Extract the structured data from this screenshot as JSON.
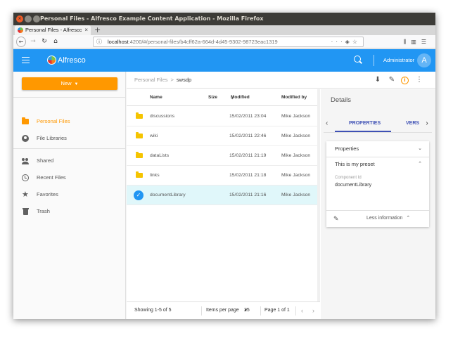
{
  "window": {
    "title": "Personal Files - Alfresco Example Content Application - Mozilla Firefox",
    "tab_title": "Personal Files - Alfresco",
    "new_tab": "+",
    "url_host": "localhost",
    "url_rest": ":4200/#/personal-files/b4cff62a-664d-4d45-9302-98723eac1319"
  },
  "app": {
    "logo_text": "Alfresco",
    "username": "Administrator",
    "avatar_letter": "A"
  },
  "sidebar": {
    "new_button": "New",
    "items": [
      {
        "label": "Personal Files",
        "icon": "folder-icon"
      },
      {
        "label": "File Libraries",
        "icon": "library-icon"
      },
      {
        "label": "Shared",
        "icon": "people-icon"
      },
      {
        "label": "Recent Files",
        "icon": "clock-icon"
      },
      {
        "label": "Favorites",
        "icon": "star-icon"
      },
      {
        "label": "Trash",
        "icon": "trash-icon"
      }
    ]
  },
  "breadcrumb": {
    "root": "Personal Files",
    "separator": ">",
    "current": "swsdp"
  },
  "table": {
    "headers": {
      "name": "Name",
      "size": "Size",
      "modified": "Modified",
      "modified_by": "Modified by"
    },
    "rows": [
      {
        "name": "discussions",
        "size": "",
        "modified": "15/02/2011 23:04",
        "by": "Mike Jackson"
      },
      {
        "name": "wiki",
        "size": "",
        "modified": "15/02/2011 22:46",
        "by": "Mike Jackson"
      },
      {
        "name": "dataLists",
        "size": "",
        "modified": "15/02/2011 21:19",
        "by": "Mike Jackson"
      },
      {
        "name": "links",
        "size": "",
        "modified": "15/02/2011 21:18",
        "by": "Mike Jackson"
      },
      {
        "name": "documentLibrary",
        "size": "",
        "modified": "15/02/2011 21:16",
        "by": "Mike Jackson",
        "selected": true
      }
    ]
  },
  "pagination": {
    "showing": "Showing 1-5 of 5",
    "items_per_page_label": "Items per page",
    "items_per_page_value": "25",
    "page": "Page 1 of 1"
  },
  "details": {
    "title": "Details",
    "tab_properties": "PROPERTIES",
    "tab_versions": "VERS",
    "properties_header": "Properties",
    "preset_header": "This is my preset",
    "component_id_label": "Component Id",
    "component_id_value": "documentLibrary",
    "less_info": "Less information"
  },
  "colors": {
    "appbar": "#2196f3",
    "accent": "#ff9800",
    "selected_row": "#e0f7fa",
    "tab_indicator": "#3f51b5"
  }
}
